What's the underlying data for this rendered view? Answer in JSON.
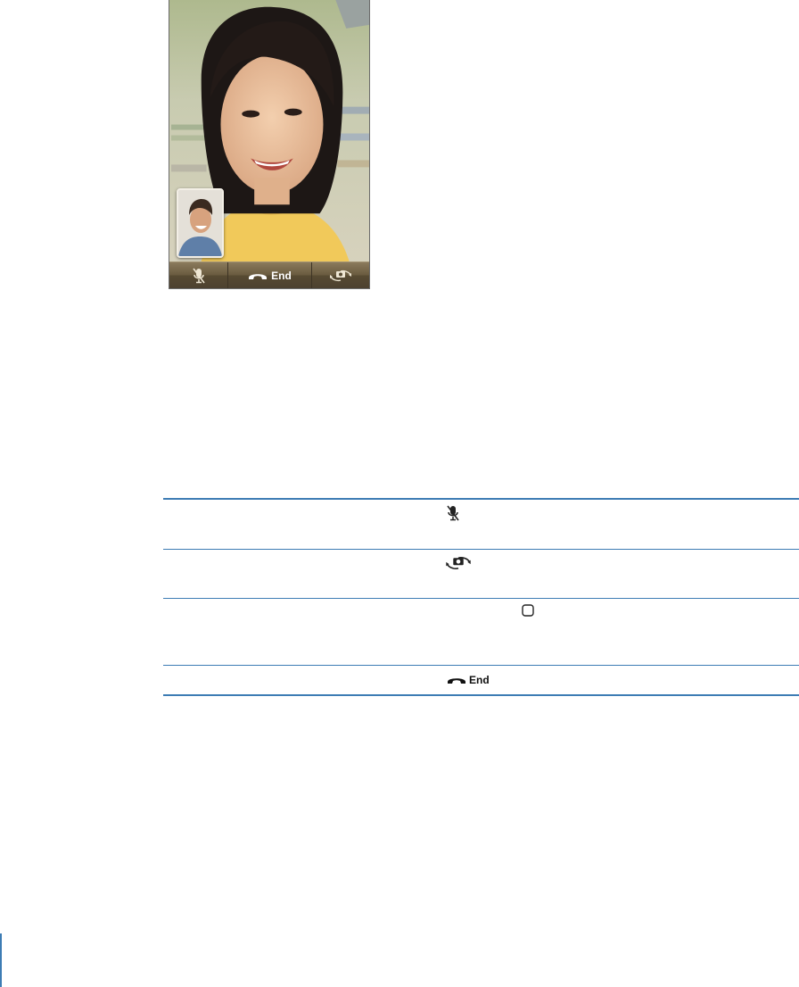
{
  "phone": {
    "call_bar": {
      "end_label": "End",
      "mute_icon": "mute-microphone-icon",
      "end_icon": "phone-handset-icon",
      "flip_icon": "camera-switch-icon"
    }
  },
  "table": {
    "rows": [
      {
        "icon": "mute-microphone-icon"
      },
      {
        "icon": "camera-switch-icon"
      },
      {
        "icon": "home-button-icon"
      },
      {
        "icon": "phone-handset-icon",
        "label": "End"
      }
    ]
  },
  "colors": {
    "rule": "#3d7cb4",
    "call_bar": "#6b5c40"
  }
}
